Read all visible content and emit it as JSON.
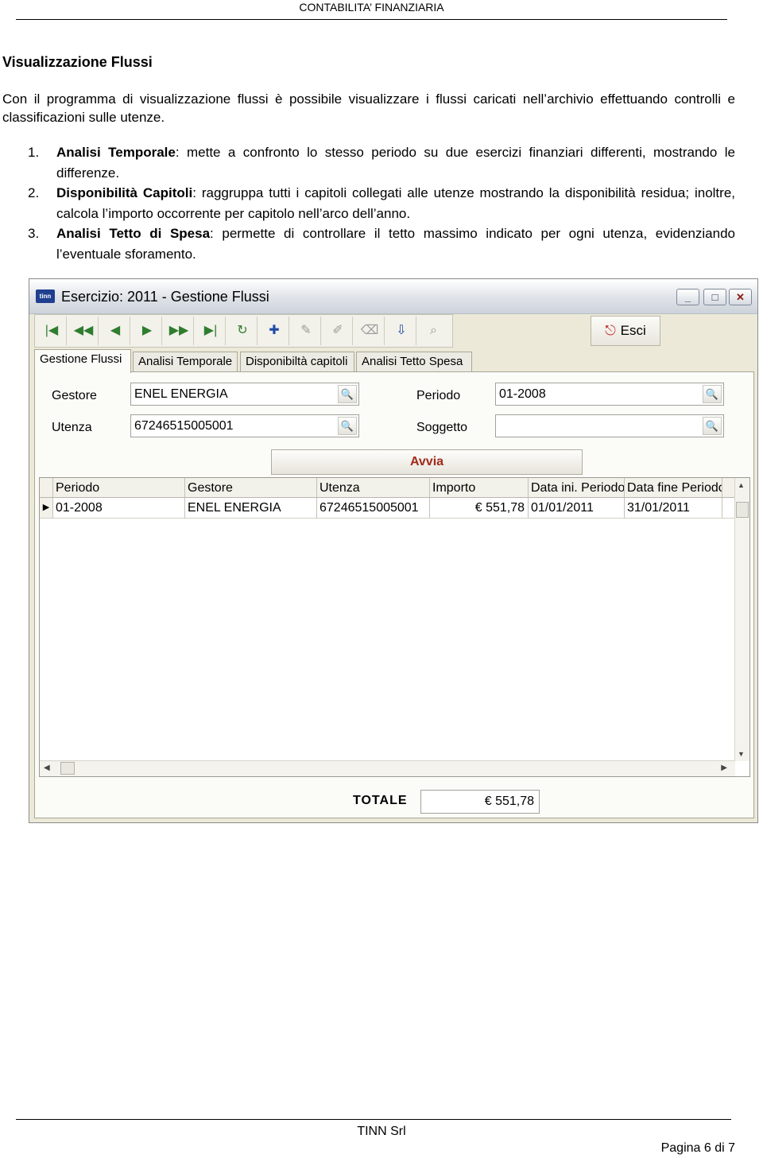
{
  "header": {
    "title": "CONTABILITA’ FINANZIARIA"
  },
  "section_title": "Visualizzazione Flussi",
  "intro": "Con il programma di visualizzazione flussi è possibile visualizzare i flussi caricati nell’archivio effettuando controlli e classificazioni sulle utenze.",
  "items": [
    {
      "num": "1.",
      "term": "Analisi Temporale",
      "text": ": mette a confronto lo stesso periodo su due esercizi finanziari differenti, mostrando le differenze."
    },
    {
      "num": "2.",
      "term": "Disponibilità Capitoli",
      "text": ": raggruppa tutti i capitoli collegati alle utenze mostrando la disponibilità residua; inoltre, calcola l’importo occorrente per capitolo nell’arco dell’anno."
    },
    {
      "num": "3.",
      "term": "Analisi Tetto di Spesa",
      "text": ": permette di controllare il tetto massimo indicato per ogni utenza, evidenziando l’eventuale sforamento."
    }
  ],
  "window": {
    "logo": "tinn",
    "title": "Esercizio: 2011 - Gestione Flussi",
    "controls": {
      "minimize": "_",
      "maximize": "□",
      "close": "✕"
    },
    "toolbar": {
      "icons": [
        "first-record-icon",
        "previous-page-icon",
        "previous-record-icon",
        "next-record-icon",
        "next-page-icon",
        "last-record-icon",
        "refresh-icon",
        "new-record-icon",
        "edit-record-icon",
        "delete-record-icon",
        "cancel-icon",
        "import-icon",
        "search-icon"
      ],
      "esci": "Esci"
    },
    "tabs": [
      "Gestione Flussi",
      "Analisi Temporale",
      "Disponibiltà capitoli",
      "Analisi Tetto Spesa"
    ],
    "form": {
      "gestore_label": "Gestore",
      "gestore_value": "ENEL ENERGIA",
      "periodo_label": "Periodo",
      "periodo_value": "01-2008",
      "utenza_label": "Utenza",
      "utenza_value": "67246515005001",
      "soggetto_label": "Soggetto",
      "soggetto_value": ""
    },
    "avvia": "Avvia",
    "grid": {
      "columns": [
        "Periodo",
        "Gestore",
        "Utenza",
        "Importo",
        "Data ini. Periodo",
        "Data fine Periodo"
      ],
      "rows": [
        {
          "periodo": "01-2008",
          "gestore": "ENEL ENERGIA",
          "utenza": "67246515005001",
          "importo": "€ 551,78",
          "data_ini": "01/01/2011",
          "data_fine": "31/01/2011"
        }
      ]
    },
    "totale_label": "TOTALE",
    "totale_value": "€ 551,78"
  },
  "footer": {
    "company": "TINN Srl",
    "page": "Pagina 6 di 7"
  }
}
